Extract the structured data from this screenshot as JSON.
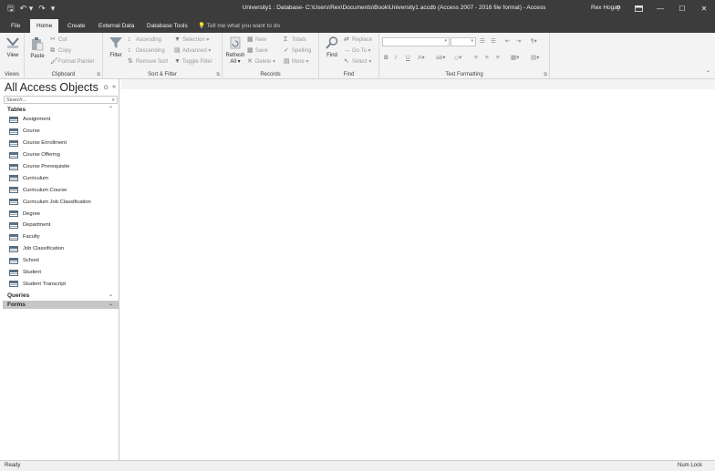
{
  "window": {
    "title": "University1 : Database- C:\\Users\\Rex\\Documents\\Book\\University1.accdb (Access 2007 - 2016 file format) - Access",
    "user": "Rex Hogan",
    "help": "?",
    "minimize": "—",
    "maximize": "☐",
    "close": "✕"
  },
  "qat": {
    "save": "🖫",
    "undo": "↶ ▾",
    "redo": "↷",
    "customize": "▾"
  },
  "tabs": [
    {
      "label": "File"
    },
    {
      "label": "Home"
    },
    {
      "label": "Create"
    },
    {
      "label": "External Data"
    },
    {
      "label": "Database Tools"
    }
  ],
  "tellme": {
    "placeholder": "Tell me what you want to do"
  },
  "ribbon": {
    "views": {
      "label": "Views",
      "view": "View"
    },
    "clipboard": {
      "label": "Clipboard",
      "paste": "Paste",
      "cut": "Cut",
      "copy": "Copy",
      "format_painter": "Format Painter"
    },
    "sort_filter": {
      "label": "Sort & Filter",
      "filter": "Filter",
      "ascending": "Ascending",
      "descending": "Descending",
      "remove_sort": "Remove Sort",
      "selection": "Selection ▾",
      "advanced": "Advanced ▾",
      "toggle_filter": "Toggle Filter"
    },
    "records": {
      "label": "Records",
      "refresh": "Refresh All ▾",
      "new": "New",
      "save": "Save",
      "delete": "Delete ▾",
      "totals": "Totals",
      "spelling": "Spelling",
      "more": "More ▾"
    },
    "find": {
      "label": "Find",
      "find": "Find",
      "replace": "Replace",
      "goto": "Go To ▾",
      "select": "Select ▾"
    },
    "text_formatting": {
      "label": "Text Formatting",
      "bold": "B",
      "italic": "I",
      "underline": "U"
    }
  },
  "nav": {
    "title": "All Access Objects",
    "search_placeholder": "Search...",
    "sections": {
      "tables": "Tables",
      "queries": "Queries",
      "forms": "Forms"
    },
    "tables": [
      {
        "label": "Assignment"
      },
      {
        "label": "Course"
      },
      {
        "label": "Course Enrollment"
      },
      {
        "label": "Course Offering"
      },
      {
        "label": "Course Prerequisite"
      },
      {
        "label": "Curriculum"
      },
      {
        "label": "Curriculum Course"
      },
      {
        "label": "Curriculum Job Classification"
      },
      {
        "label": "Degree"
      },
      {
        "label": "Department"
      },
      {
        "label": "Faculty"
      },
      {
        "label": "Job Classification"
      },
      {
        "label": "School"
      },
      {
        "label": "Student"
      },
      {
        "label": "Student Transcript"
      }
    ]
  },
  "status": {
    "left": "Ready",
    "right": "Num Lock"
  },
  "colors": {
    "titlebar": "#3c3c3c",
    "ribbon": "#f3f3f3",
    "selected_section": "#c6c6c6"
  }
}
